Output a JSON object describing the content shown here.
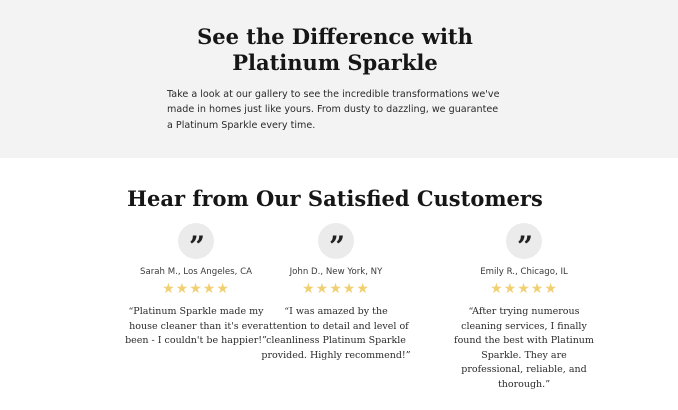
{
  "gallery": {
    "title": "See the Difference with Platinum Sparkle",
    "text": "Take a look at our gallery to see the incredible transformations we've made in homes just like yours. From dusty to dazzling, we guarantee a Platinum Sparkle every time."
  },
  "testimonials": {
    "title": "Hear from Our Satisfied Customers",
    "rating_color": "#f0d073",
    "items": [
      {
        "name": "Sarah M., Los Angeles, CA",
        "stars": 5,
        "text": "“Platinum Sparkle made my house cleaner than it's ever been - I couldn't be happier!”"
      },
      {
        "name": "John D., New York, NY",
        "stars": 5,
        "text": "“I was amazed by the attention to detail and level of cleanliness Platinum Sparkle provided. Highly recommend!”"
      },
      {
        "name": "Emily R., Chicago, IL",
        "stars": 5,
        "text": "“After trying numerous cleaning services, I finally found the best with Platinum Sparkle. They are professional, reliable, and thorough.”"
      }
    ]
  }
}
